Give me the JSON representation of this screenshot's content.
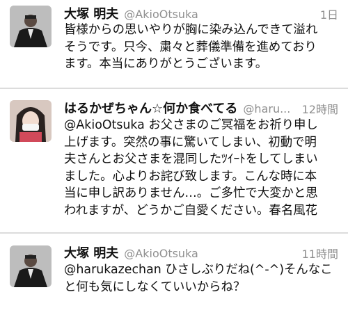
{
  "tweets": [
    {
      "name": "大塚 明夫",
      "handle": "@AkioOtsuka",
      "time": "1日",
      "lines": [
        "皆様からの思いやりが胸に染み込んできて溢れ",
        "そうです。只今、粛々と葬儀準備を進めており",
        "ます。本当にありがとうございます。"
      ]
    },
    {
      "name": "はるかぜちゃん☆何か食べてる",
      "handle": "@haru...",
      "time": "12時間",
      "lines": [
        "@AkioOtsuka お父さまのご冥福をお祈り申し",
        "上げます。突然の事に驚いてしまい、初動で明",
        "夫さんとお父さまを混同したﾂｲｰﾄをしてしまい",
        "ました。心よりお詫び致します。こんな時に本",
        "当に申し訳ありません…。ご多忙で大変かと思",
        "われますが、どうかご自愛ください。春名風花"
      ]
    },
    {
      "name": "大塚 明夫",
      "handle": "@AkioOtsuka",
      "time": "11時間",
      "lines": [
        "@harukazechan ひさしぶりだね(^-^)そんなこ",
        "と何も気にしなくていいからね？"
      ]
    }
  ],
  "colors": {
    "text": "#111111",
    "meta": "#8f8f8f",
    "divider": "#dcdcdc"
  },
  "icons": [
    "avatar-akio-icon",
    "avatar-haru-icon"
  ]
}
